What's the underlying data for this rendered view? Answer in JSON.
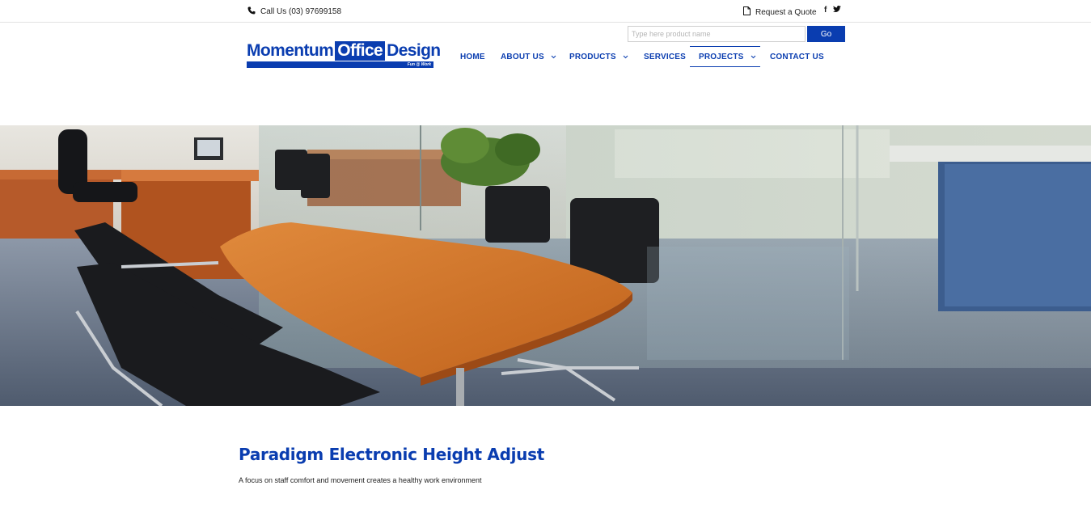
{
  "topbar": {
    "phone_icon": "phone-icon",
    "call_text": "Call Us (03) 97699158",
    "quote_icon": "document-icon",
    "quote_text": "Request a Quote",
    "social": {
      "facebook": "f",
      "twitter_icon": "twitter-icon"
    }
  },
  "logo": {
    "word1": "Momentum",
    "word2": "Office",
    "word3": "Design",
    "tagline": "Fun @ Work"
  },
  "search": {
    "placeholder": "Type here product name",
    "button_label": "Go"
  },
  "nav": {
    "items": [
      {
        "label": "HOME",
        "has_dropdown": false
      },
      {
        "label": "ABOUT US",
        "has_dropdown": true
      },
      {
        "label": "PRODUCTS",
        "has_dropdown": true
      },
      {
        "label": "SERVICES",
        "has_dropdown": false
      },
      {
        "label": "PROJECTS",
        "has_dropdown": true,
        "active": true
      },
      {
        "label": "CONTACT US",
        "has_dropdown": false
      }
    ],
    "chevron": "⌄"
  },
  "hero": {
    "image": "office-meeting-room-photo"
  },
  "content": {
    "title": "Paradigm Electronic Height Adjust",
    "subtitle": "A focus on staff comfort and movement creates a healthy work environment"
  },
  "colors": {
    "brand_blue": "#0a3db0",
    "text": "#222222"
  }
}
